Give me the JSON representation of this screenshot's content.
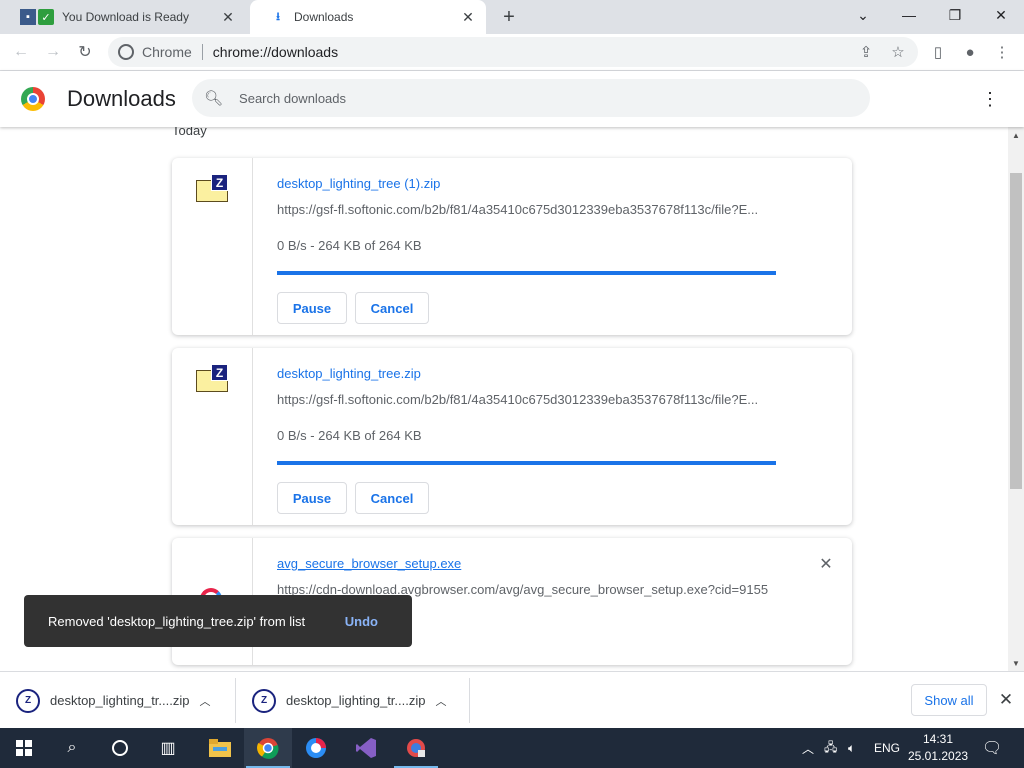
{
  "browser": {
    "tabs": [
      {
        "title": "You Download is Ready",
        "active": false
      },
      {
        "title": "Downloads",
        "active": true
      }
    ],
    "omnibox": {
      "site_name": "Chrome",
      "url": "chrome://downloads"
    }
  },
  "downloads_page": {
    "title": "Downloads",
    "search_placeholder": "Search downloads",
    "date_group": "Today",
    "items": [
      {
        "filename": "desktop_lighting_tree (1).zip",
        "url": "https://gsf-fl.softonic.com/b2b/f81/4a35410c675d3012339eba3537678f113c/file?E...",
        "status": "0 B/s - 264 KB of 264 KB",
        "progress": 1.0,
        "pause_label": "Pause",
        "cancel_label": "Cancel"
      },
      {
        "filename": "desktop_lighting_tree.zip",
        "url": "https://gsf-fl.softonic.com/b2b/f81/4a35410c675d3012339eba3537678f113c/file?E...",
        "status": "0 B/s - 264 KB of 264 KB",
        "progress": 1.0,
        "pause_label": "Pause",
        "cancel_label": "Cancel"
      },
      {
        "filename": "avg_secure_browser_setup.exe",
        "url": "https://cdn-download.avgbrowser.com/avg/avg_secure_browser_setup.exe?cid=9155"
      }
    ]
  },
  "toast": {
    "message": "Removed 'desktop_lighting_tree.zip' from list",
    "action": "Undo"
  },
  "shelf": {
    "items": [
      {
        "name": "desktop_lighting_tr....zip"
      },
      {
        "name": "desktop_lighting_tr....zip"
      }
    ],
    "show_all_label": "Show all"
  },
  "taskbar": {
    "language": "ENG",
    "time": "14:31",
    "date": "25.01.2023"
  },
  "colors": {
    "accent": "#1a73e8",
    "taskbar": "#1f2a3a"
  }
}
